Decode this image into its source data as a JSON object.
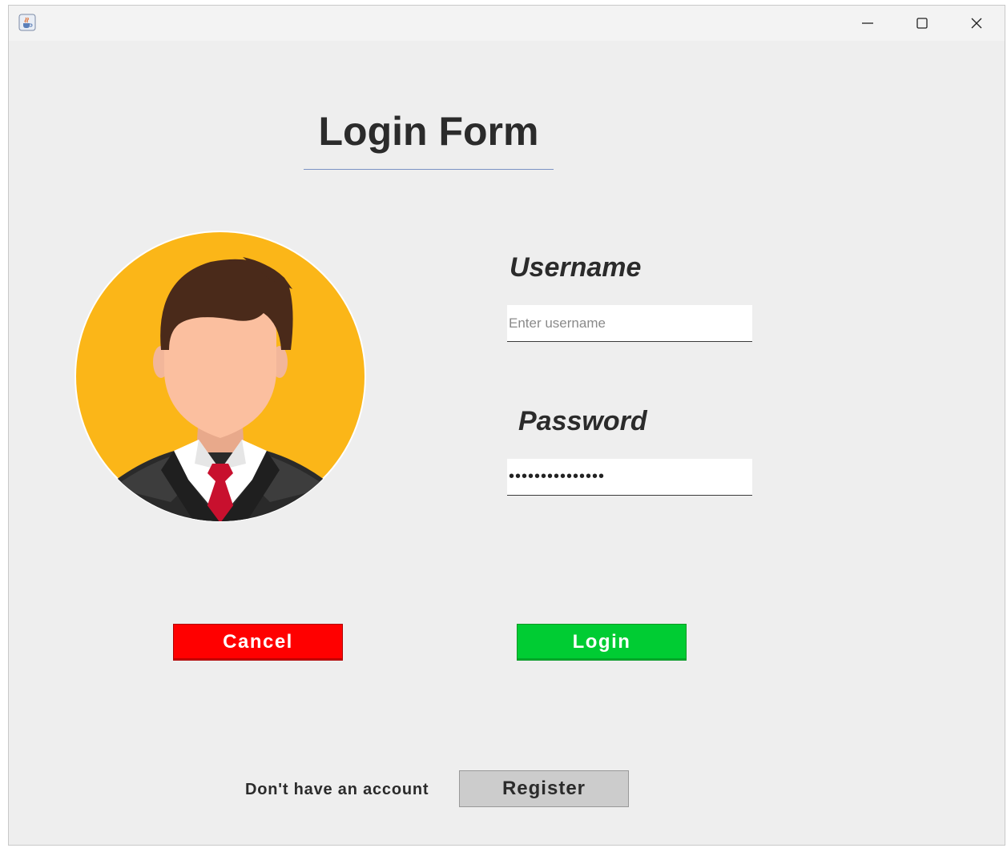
{
  "window": {
    "app_icon": "java-coffee-cup-icon",
    "controls": {
      "minimize": "minimize-icon",
      "maximize": "maximize-icon",
      "close": "close-icon"
    }
  },
  "form": {
    "title": "Login Form",
    "avatar_icon": "user-avatar-icon",
    "username": {
      "label": "Username",
      "placeholder": "Enter username",
      "value": ""
    },
    "password": {
      "label": "Password",
      "value": "•••••••••••••••"
    }
  },
  "buttons": {
    "cancel_label": "Cancel",
    "login_label": "Login",
    "register_label": "Register"
  },
  "footer": {
    "prompt": "Don't have an account"
  },
  "colors": {
    "window_bg": "#eeeeee",
    "cancel_bg": "#ff0000",
    "login_bg": "#00cc33",
    "register_bg": "#cccccc",
    "avatar_bg": "#fbb618",
    "title_underline": "#7b93c4"
  }
}
